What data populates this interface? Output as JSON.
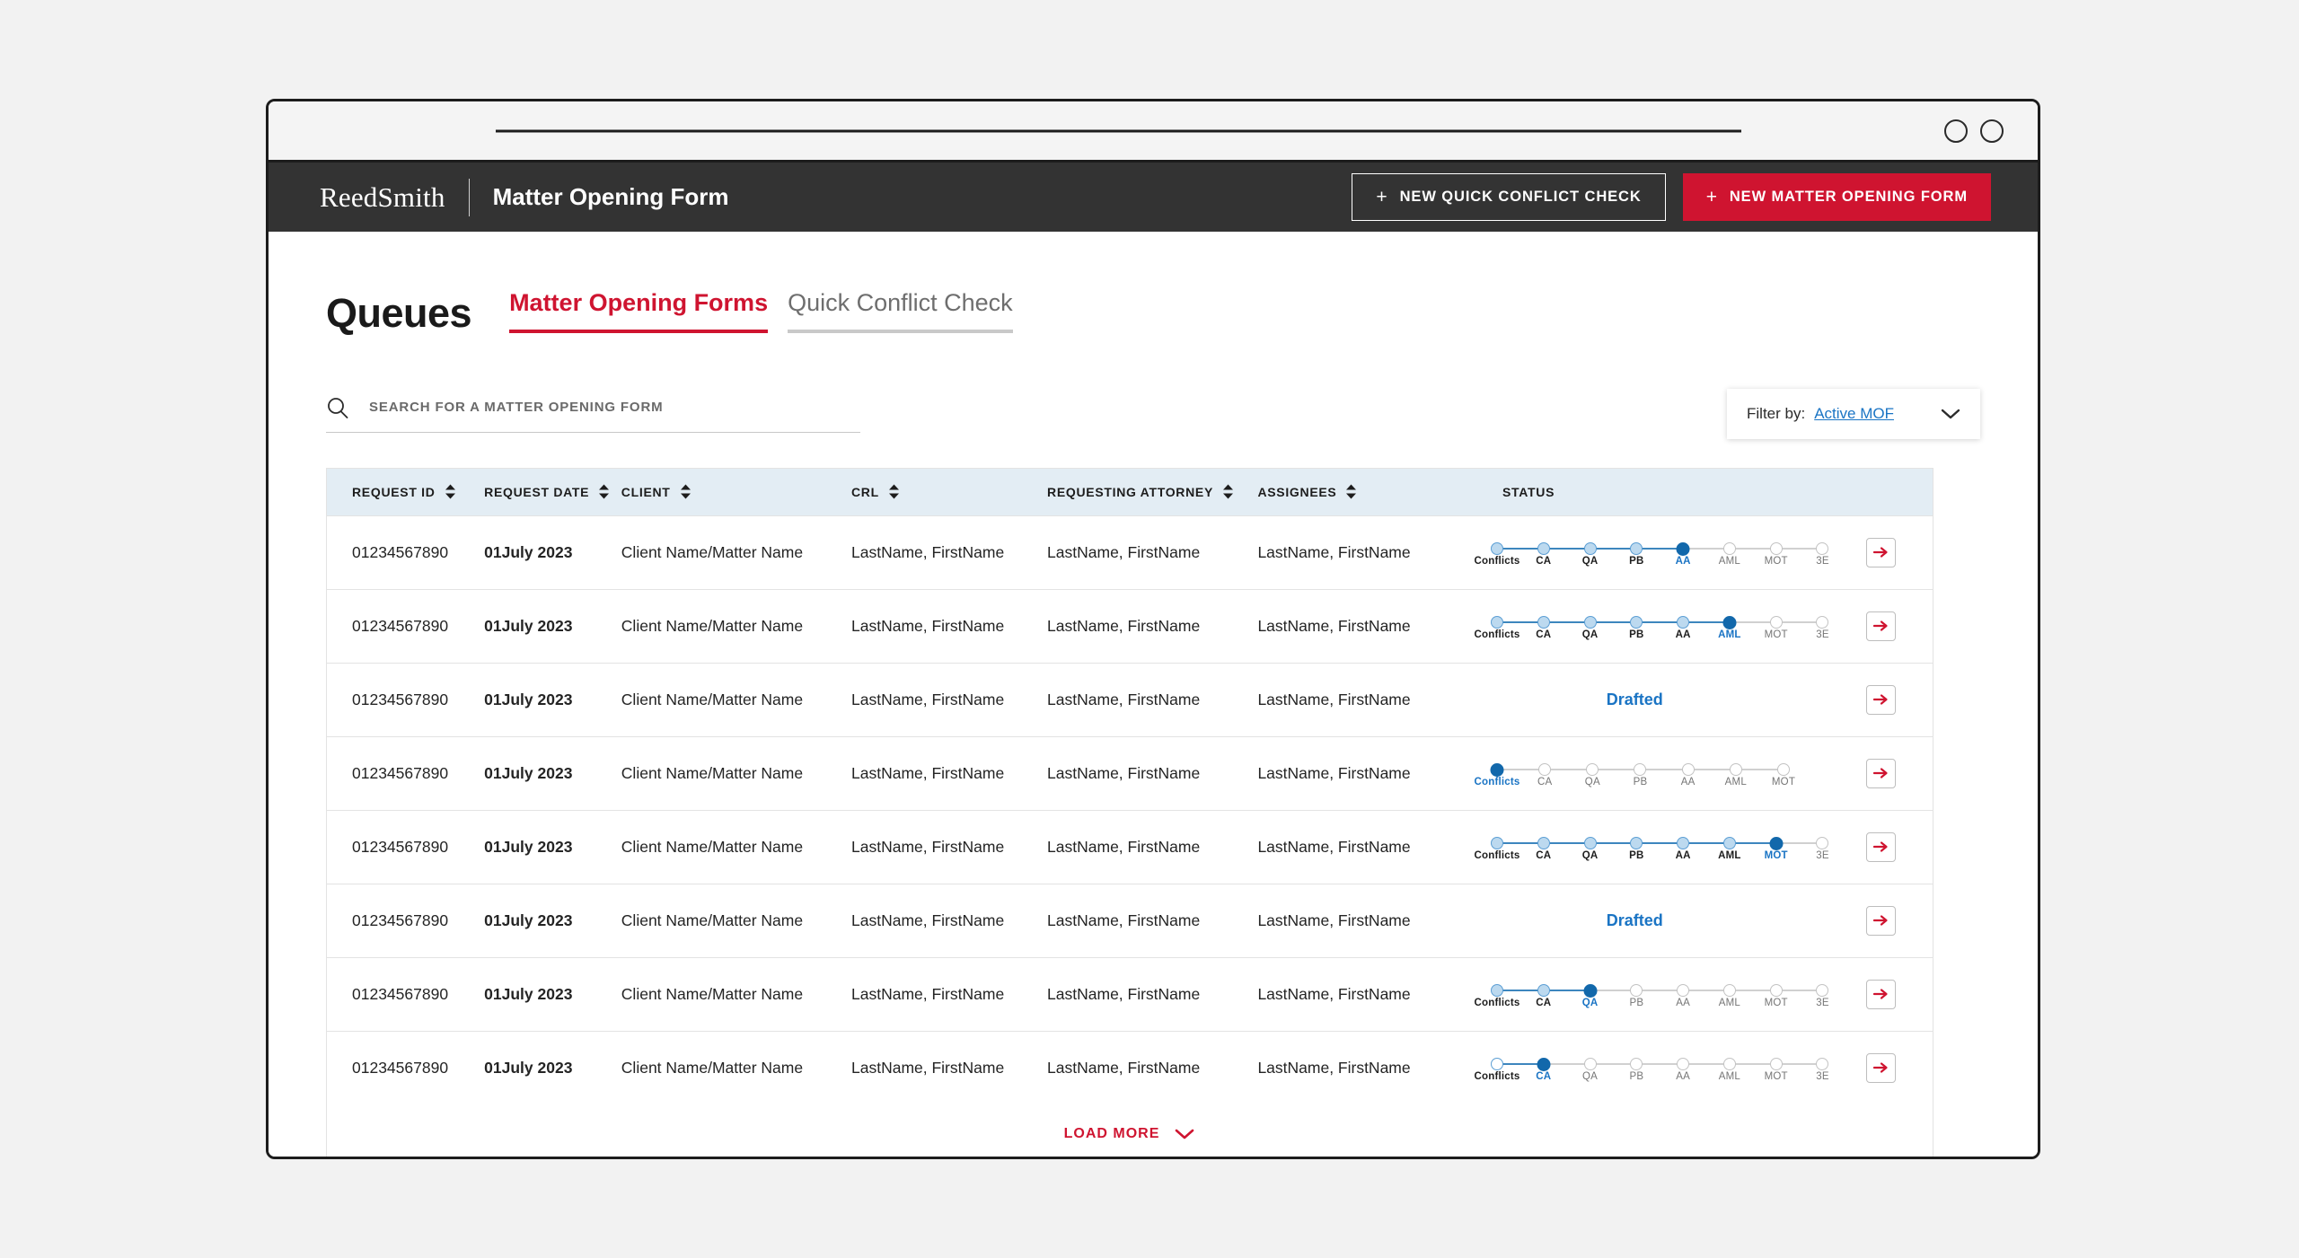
{
  "browser": {
    "url_placeholder": "",
    "window_controls": [
      "circle-1",
      "circle-2"
    ]
  },
  "header": {
    "brand": "ReedSmith",
    "title": "Matter Opening Form",
    "buttons": [
      {
        "label": "NEW QUICK CONFLICT CHECK",
        "style": "outline",
        "icon": "plus-icon"
      },
      {
        "label": "NEW MATTER OPENING FORM",
        "style": "primary",
        "icon": "plus-icon"
      }
    ]
  },
  "page": {
    "title": "Queues",
    "tabs": [
      {
        "label": "Matter Opening Forms",
        "active": true
      },
      {
        "label": "Quick Conflict Check",
        "active": false
      }
    ]
  },
  "search": {
    "placeholder": "SEARCH FOR A MATTER OPENING FORM",
    "value": "",
    "icon": "search-icon"
  },
  "filter": {
    "label": "Filter by:",
    "value": "Active MOF",
    "icon": "chevron-down-icon"
  },
  "table": {
    "columns": [
      {
        "label": "REQUEST ID",
        "sortable": true
      },
      {
        "label": "REQUEST DATE",
        "sortable": true
      },
      {
        "label": "CLIENT",
        "sortable": true
      },
      {
        "label": "CRL",
        "sortable": true
      },
      {
        "label": "REQUESTING ATTORNEY",
        "sortable": true
      },
      {
        "label": "ASSIGNEES",
        "sortable": true
      },
      {
        "label": "STATUS",
        "sortable": false
      },
      {
        "label": "",
        "sortable": false
      }
    ],
    "rows": [
      {
        "request_id": "01234567890",
        "request_date": "01July 2023",
        "client": "Client Name/Matter Name",
        "crl": "LastName, FirstName",
        "requesting_attorney": "LastName, FirstName",
        "assignees": "LastName, FirstName",
        "status_type": "stepper",
        "steps": [
          "Conflicts",
          "CA",
          "QA",
          "PB",
          "AA",
          "AML",
          "MOT",
          "3E"
        ],
        "current_step_index": 4,
        "action": "open-arrow-icon"
      },
      {
        "request_id": "01234567890",
        "request_date": "01July 2023",
        "client": "Client Name/Matter Name",
        "crl": "LastName, FirstName",
        "requesting_attorney": "LastName, FirstName",
        "assignees": "LastName, FirstName",
        "status_type": "stepper",
        "steps": [
          "Conflicts",
          "CA",
          "QA",
          "PB",
          "AA",
          "AML",
          "MOT",
          "3E"
        ],
        "current_step_index": 5,
        "action": "open-arrow-icon"
      },
      {
        "request_id": "01234567890",
        "request_date": "01July 2023",
        "client": "Client Name/Matter Name",
        "crl": "LastName, FirstName",
        "requesting_attorney": "LastName, FirstName",
        "assignees": "LastName, FirstName",
        "status_type": "text",
        "status_text": "Drafted",
        "action": "open-arrow-icon"
      },
      {
        "request_id": "01234567890",
        "request_date": "01July 2023",
        "client": "Client Name/Matter Name",
        "crl": "LastName, FirstName",
        "requesting_attorney": "LastName, FirstName",
        "assignees": "LastName, FirstName",
        "status_type": "stepper",
        "steps": [
          "Conflicts",
          "CA",
          "QA",
          "PB",
          "AA",
          "AML",
          "MOT"
        ],
        "current_step_index": 0,
        "action": "open-arrow-icon"
      },
      {
        "request_id": "01234567890",
        "request_date": "01July 2023",
        "client": "Client Name/Matter Name",
        "crl": "LastName, FirstName",
        "requesting_attorney": "LastName, FirstName",
        "assignees": "LastName, FirstName",
        "status_type": "stepper",
        "steps": [
          "Conflicts",
          "CA",
          "QA",
          "PB",
          "AA",
          "AML",
          "MOT",
          "3E"
        ],
        "current_step_index": 6,
        "action": "open-arrow-icon"
      },
      {
        "request_id": "01234567890",
        "request_date": "01July 2023",
        "client": "Client Name/Matter Name",
        "crl": "LastName, FirstName",
        "requesting_attorney": "LastName, FirstName",
        "assignees": "LastName, FirstName",
        "status_type": "text",
        "status_text": "Drafted",
        "action": "open-arrow-icon"
      },
      {
        "request_id": "01234567890",
        "request_date": "01July 2023",
        "client": "Client Name/Matter Name",
        "crl": "LastName, FirstName",
        "requesting_attorney": "LastName, FirstName",
        "assignees": "LastName, FirstName",
        "status_type": "stepper",
        "steps": [
          "Conflicts",
          "CA",
          "QA",
          "PB",
          "AA",
          "AML",
          "MOT",
          "3E"
        ],
        "current_step_index": 2,
        "action": "open-arrow-icon"
      },
      {
        "request_id": "01234567890",
        "request_date": "01July 2023",
        "client": "Client Name/Matter Name",
        "crl": "LastName, FirstName",
        "requesting_attorney": "LastName, FirstName",
        "assignees": "LastName, FirstName",
        "status_type": "stepper",
        "steps": [
          "Conflicts",
          "CA",
          "QA",
          "PB",
          "AA",
          "AML",
          "MOT",
          "3E"
        ],
        "current_step_index": 1,
        "action": "open-arrow-icon"
      }
    ],
    "load_more": {
      "label": "LOAD MORE",
      "icon": "chevron-down-icon"
    }
  },
  "colors": {
    "brand_red": "#cf1430",
    "header_dark": "#333333",
    "table_header_bg": "#e3edf4",
    "link_blue": "#1a74c4",
    "step_current": "#1268ab",
    "step_done": "#bcd9ef",
    "step_todo": "#c3c3c3"
  }
}
